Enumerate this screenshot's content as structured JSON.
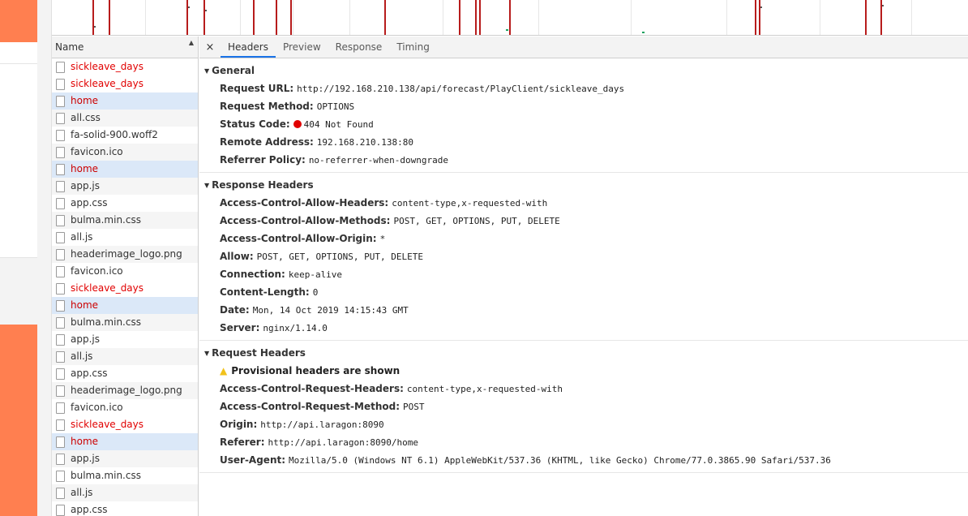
{
  "name_column": {
    "header": "Name",
    "requests": [
      {
        "label": "sickleave_days",
        "state": "error"
      },
      {
        "label": "sickleave_days",
        "state": "error"
      },
      {
        "label": "home",
        "state": "selected"
      },
      {
        "label": "all.css",
        "state": "normal"
      },
      {
        "label": "fa-solid-900.woff2",
        "state": "normal"
      },
      {
        "label": "favicon.ico",
        "state": "normal"
      },
      {
        "label": "home",
        "state": "selected"
      },
      {
        "label": "app.js",
        "state": "normal"
      },
      {
        "label": "app.css",
        "state": "normal"
      },
      {
        "label": "bulma.min.css",
        "state": "normal"
      },
      {
        "label": "all.js",
        "state": "normal"
      },
      {
        "label": "headerimage_logo.png",
        "state": "normal"
      },
      {
        "label": "favicon.ico",
        "state": "normal"
      },
      {
        "label": "sickleave_days",
        "state": "error"
      },
      {
        "label": "home",
        "state": "selected"
      },
      {
        "label": "bulma.min.css",
        "state": "normal"
      },
      {
        "label": "app.js",
        "state": "normal"
      },
      {
        "label": "all.js",
        "state": "normal"
      },
      {
        "label": "app.css",
        "state": "normal"
      },
      {
        "label": "headerimage_logo.png",
        "state": "normal"
      },
      {
        "label": "favicon.ico",
        "state": "normal"
      },
      {
        "label": "sickleave_days",
        "state": "error"
      },
      {
        "label": "home",
        "state": "selected"
      },
      {
        "label": "app.js",
        "state": "normal"
      },
      {
        "label": "bulma.min.css",
        "state": "normal"
      },
      {
        "label": "all.js",
        "state": "normal"
      },
      {
        "label": "app.css",
        "state": "normal"
      }
    ]
  },
  "tabs": {
    "close": "×",
    "headers": "Headers",
    "preview": "Preview",
    "response": "Response",
    "timing": "Timing"
  },
  "general": {
    "title": "General",
    "rows": [
      {
        "name": "Request URL:",
        "value": "http://192.168.210.138/api/forecast/PlayClient/sickleave_days"
      },
      {
        "name": "Request Method:",
        "value": "OPTIONS"
      },
      {
        "name": "Status Code:",
        "value": "404 Not Found"
      },
      {
        "name": "Remote Address:",
        "value": "192.168.210.138:80"
      },
      {
        "name": "Referrer Policy:",
        "value": "no-referrer-when-downgrade"
      }
    ]
  },
  "response_headers": {
    "title": "Response Headers",
    "rows": [
      {
        "name": "Access-Control-Allow-Headers:",
        "value": "content-type,x-requested-with"
      },
      {
        "name": "Access-Control-Allow-Methods:",
        "value": "POST, GET, OPTIONS, PUT, DELETE"
      },
      {
        "name": "Access-Control-Allow-Origin:",
        "value": "*"
      },
      {
        "name": "Allow:",
        "value": "POST, GET, OPTIONS, PUT, DELETE"
      },
      {
        "name": "Connection:",
        "value": "keep-alive"
      },
      {
        "name": "Content-Length:",
        "value": "0"
      },
      {
        "name": "Date:",
        "value": "Mon, 14 Oct 2019 14:15:43 GMT"
      },
      {
        "name": "Server:",
        "value": "nginx/1.14.0"
      }
    ]
  },
  "request_headers": {
    "title": "Request Headers",
    "warning": "Provisional headers are shown",
    "rows": [
      {
        "name": "Access-Control-Request-Headers:",
        "value": "content-type,x-requested-with"
      },
      {
        "name": "Access-Control-Request-Method:",
        "value": "POST"
      },
      {
        "name": "Origin:",
        "value": "http://api.laragon:8090"
      },
      {
        "name": "Referer:",
        "value": "http://api.laragon:8090/home"
      },
      {
        "name": "User-Agent:",
        "value": "Mozilla/5.0 (Windows NT 6.1) AppleWebKit/537.36 (KHTML, like Gecko) Chrome/77.0.3865.90 Safari/537.36"
      }
    ]
  },
  "colors": {
    "page_accent": "#ff7f50",
    "error_text": "#e10000",
    "selected_row": "#dbe8f8",
    "timeline_bar": "#b71c1c"
  },
  "icons": [
    "file-icon",
    "sort-arrow-icon",
    "close-icon",
    "collapse-triangle-icon",
    "status-dot-icon",
    "warning-icon"
  ]
}
